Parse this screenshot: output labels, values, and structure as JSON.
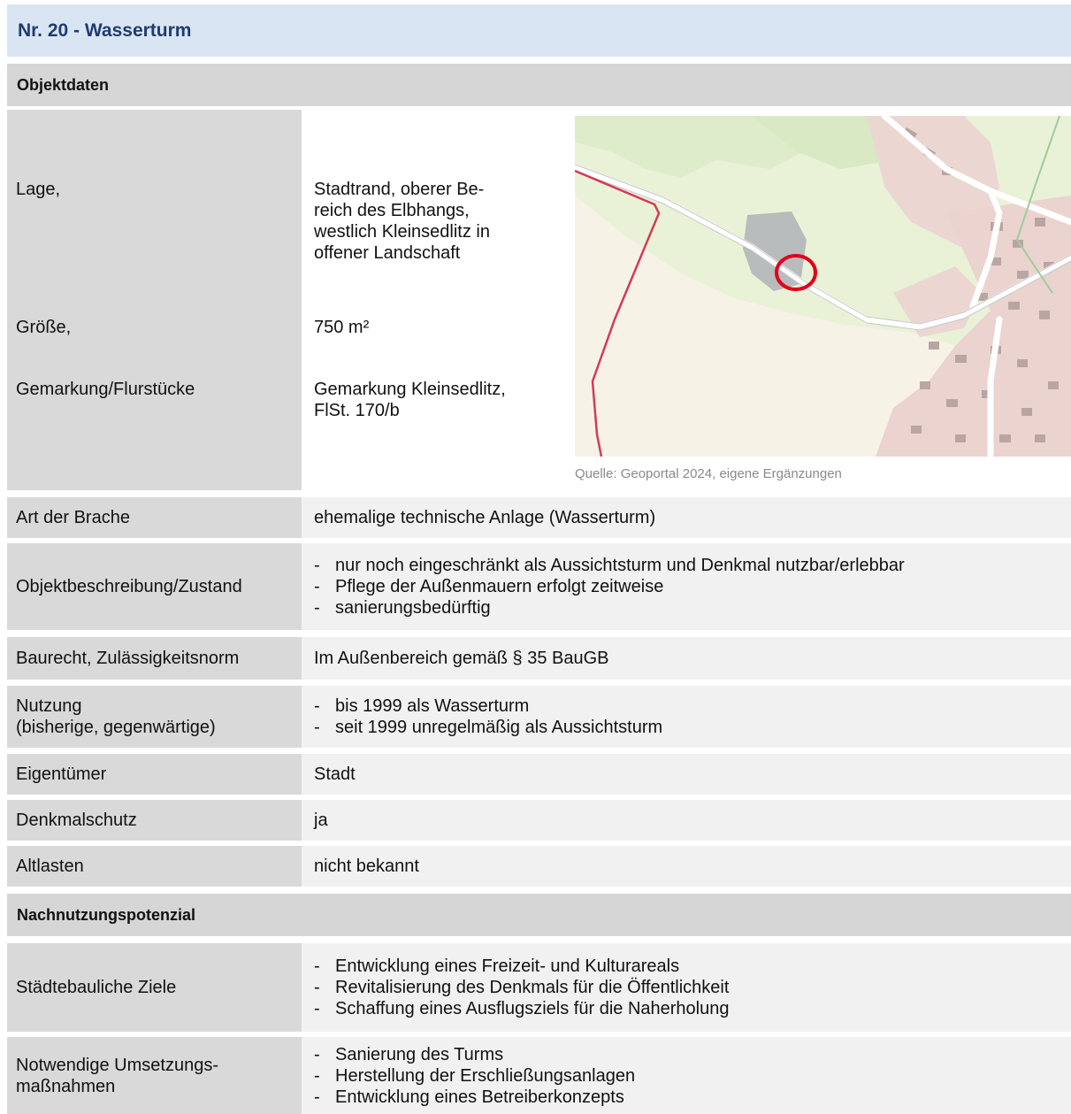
{
  "header": {
    "title": "Nr. 20 - Wasserturm"
  },
  "sections": {
    "objektdaten": "Objektdaten",
    "nachnutzung": "Nachnutzungspotenzial"
  },
  "objekt": {
    "lage_label": "Lage,",
    "lage_lines": [
      "Stadtrand, oberer Be-",
      "reich des Elbhangs,",
      "westlich Kleinsedlitz in",
      "offener Landschaft"
    ],
    "groesse_label": "Größe,",
    "groesse_value": "750 m²",
    "gemarkung_label": "Gemarkung/Flurstücke",
    "gemarkung_lines": [
      "Gemarkung Kleinsedlitz,",
      "FlSt. 170/b"
    ],
    "map_caption": "Quelle: Geoportal 2024, eigene Ergänzungen"
  },
  "rows": {
    "art": {
      "label": "Art der Brache",
      "value": "ehemalige technische Anlage (Wasserturm)"
    },
    "beschreibung": {
      "label": "Objektbeschreibung/Zustand",
      "items": [
        "nur noch eingeschränkt als Aussichtsturm und Denkmal nutzbar/erlebbar",
        "Pflege der Außenmauern erfolgt zeitweise",
        "sanierungsbedürftig"
      ]
    },
    "baurecht": {
      "label": "Baurecht, Zulässigkeitsnorm",
      "value": "Im Außenbereich gemäß § 35 BauGB"
    },
    "nutzung": {
      "label_lines": [
        "Nutzung",
        "(bisherige, gegenwärtige)"
      ],
      "items": [
        "bis 1999 als Wasserturm",
        "seit 1999 unregelmäßig als Aussichtsturm"
      ]
    },
    "eigentuemer": {
      "label": "Eigentümer",
      "value": "Stadt"
    },
    "denkmal": {
      "label": "Denkmalschutz",
      "value": "ja"
    },
    "altlasten": {
      "label": "Altlasten",
      "value": "nicht bekannt"
    },
    "ziele": {
      "label": "Städtebauliche Ziele",
      "items": [
        "Entwicklung eines Freizeit- und Kulturareals",
        "Revitalisierung des Denkmals für die Öffentlichkeit",
        "Schaffung eines Ausflugsziels für die Naherholung"
      ]
    },
    "massnahmen": {
      "label_lines": [
        "Notwendige Umsetzungs-",
        "maßnahmen"
      ],
      "items": [
        "Sanierung des Turms",
        "Herstellung der Erschließungsanlagen",
        "Entwicklung eines Betreiberkonzepts"
      ]
    }
  },
  "colors": {
    "title_bg": "#d9e5f3",
    "title_text": "#1f3c6e",
    "section_bg": "#d6d6d6",
    "label_bg": "#d9d9d9",
    "value_bg": "#f1f1f1",
    "marker": "#e0001b"
  }
}
